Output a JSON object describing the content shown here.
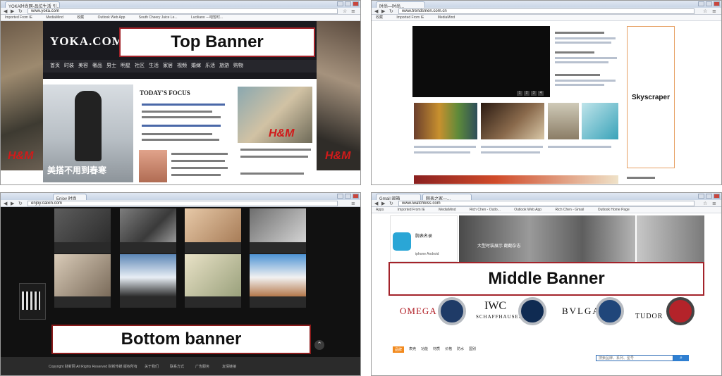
{
  "q1": {
    "tab": "YOKA时尚网-品位生活 引...",
    "url": "www.yoka.com",
    "bookmarks": [
      "Imported From IE",
      "MediaMind",
      "收藏",
      "Outlook Web App",
      "South Cheery Juice Le...",
      "Luciliano ---吧暂时..."
    ],
    "logo": "YOKA.COM",
    "nav": [
      "首页",
      "时装",
      "美容",
      "奢品",
      "男士",
      "明星",
      "社区",
      "生活",
      "家居",
      "视频",
      "婚嫁",
      "乐活",
      "旅游",
      "购物"
    ],
    "focus_title": "TODAY'S FOCUS",
    "photo_caption": "美搭不用到春寒",
    "brand_mark": "H&M",
    "label": "Top Banner"
  },
  "q2": {
    "tab": "时尚—时尚...",
    "url": "www.trendsmen.com.cn",
    "bookmarks": [
      "收藏",
      "Imported From IE",
      "MediaMind"
    ],
    "pager": [
      "1",
      "2",
      "3",
      "4"
    ],
    "label": "Skyscraper"
  },
  "q3": {
    "tab": "Enjoy 时尚",
    "url": "enjoy.caixin.com",
    "footer": [
      "Copyright 财新网 All Rights Reserved 财新传媒 版权所有",
      "关于我们",
      "联系方式",
      "广告服务",
      "友情链接"
    ],
    "label": "Bottom banner"
  },
  "q4": {
    "tabs": [
      "Gmail 邮箱",
      "腕表之家—..."
    ],
    "url": "www.iwatchkiss.com",
    "bookmarks": [
      "Apps",
      "Imported From IE",
      "MediaMind",
      "Rich Chen - Outlo...",
      "Outlook Web App",
      "Rich Chen - Gmail",
      "Outlook Home Page"
    ],
    "app_title": "腕表名录",
    "app_caption": "iphone Android",
    "hero_caption": "大型时装展示 翻翻杂志",
    "brands": [
      "OMEGA",
      "IWC",
      "SCHAFFHAUSEN",
      "BVLGARI",
      "TUDOR"
    ],
    "filters": [
      "品牌",
      "表壳",
      "功能",
      "材质",
      "价格",
      "防水",
      "国别"
    ],
    "search_placeholder": "搜索品牌、系列、型号",
    "label": "Middle Banner"
  }
}
